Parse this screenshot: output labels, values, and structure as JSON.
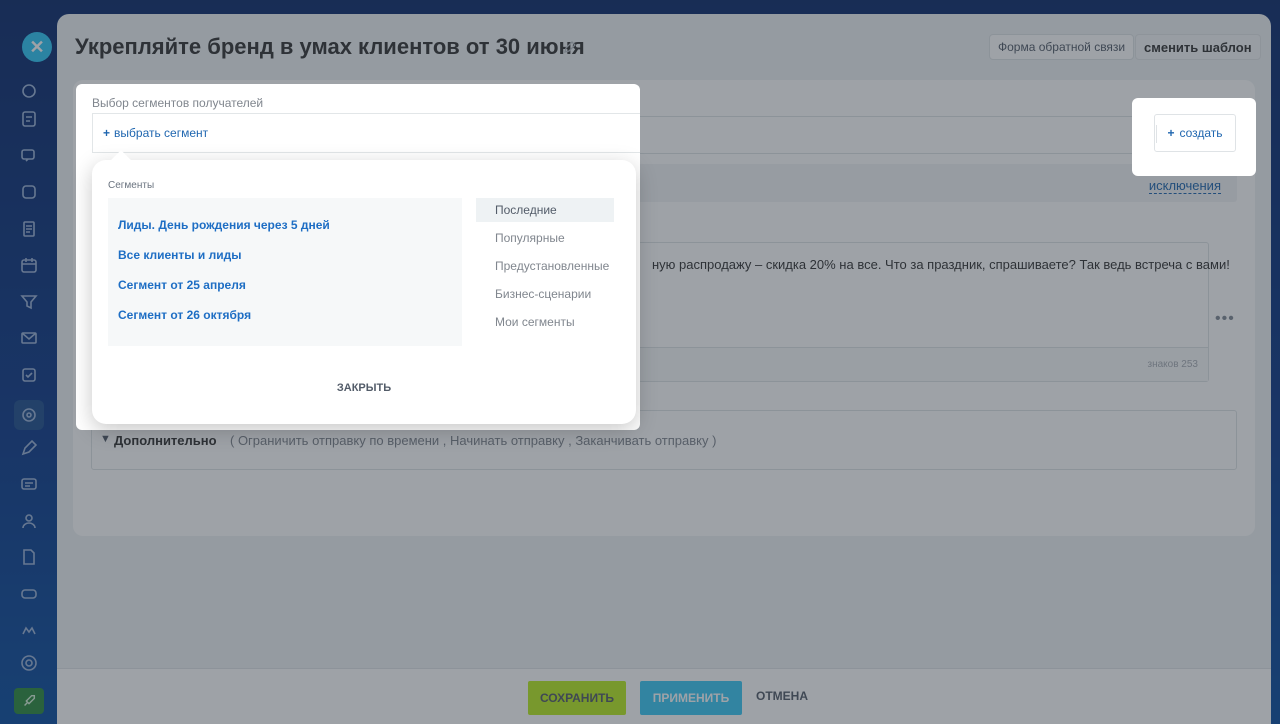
{
  "header": {
    "title": "Укрепляйте бренд в умах клиентов от 30 июня",
    "feedback_label": "Форма обратной связи",
    "change_template_label": "сменить шаблон"
  },
  "recipients": {
    "label": "Выбор сегментов получателей",
    "choose_label": "выбрать сегмент",
    "create_label": "создать",
    "exclusions_label": "исключения"
  },
  "message": {
    "text": "ную распродажу – скидка 20% на все. Что за праздник, спрашиваете? Так ведь встреча с вами!",
    "char_count": "знаков 253"
  },
  "extra": {
    "title": "Дополнительно",
    "hint": "( Ограничить отправку по времени ,  Начинать отправку ,  Заканчивать отправку  )"
  },
  "segments_popup": {
    "title": "Сегменты",
    "items": [
      "Лиды. День рождения через 5 дней",
      "Все клиенты и лиды",
      "Сегмент от 25 апреля",
      "Сегмент от 26 октября"
    ],
    "categories": [
      "Последние",
      "Популярные",
      "Предустановленные",
      "Бизнес-сценарии",
      "Мои сегменты"
    ],
    "active_category": "Последние",
    "close_label": "ЗАКРЫТЬ"
  },
  "footer": {
    "save_label": "СОХРАНИТЬ",
    "apply_label": "ПРИМЕНИТЬ",
    "cancel_label": "ОТМЕНА"
  },
  "colors": {
    "accent_blue": "#2067b0",
    "save_green": "#bbed21",
    "apply_cyan": "#3bc8f5"
  }
}
